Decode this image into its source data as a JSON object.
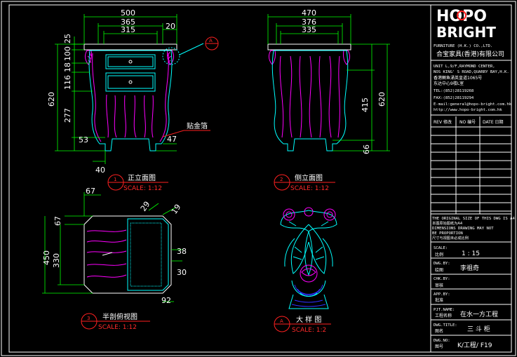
{
  "logo": {
    "top": "HOPO",
    "bottom": "BRIGHT"
  },
  "company": {
    "line_en": "FURNITURE (H.K.) CO.,LTD.",
    "line_cn": "合宝家具(香港)有限公司",
    "addr1": "UNIT L,9/F,RAYMOND CENTER,",
    "addr2": "NOS KING' S ROAD,QUARRY BAY,H.K.",
    "addr3": "香港鲗鱼涌英皇道1065号",
    "addr4": "东达中心9楼L室",
    "tel": "TEL:(852)28119268",
    "fax": "FAX:(852)28119294",
    "email": "E-mail:general@hopo-bright.com.hk",
    "web": "http://www.hopo-bright.com.hk"
  },
  "revision": {
    "rev": "REV 修改",
    "no": "NO 编号",
    "date": "DATE 日期"
  },
  "notice": [
    "THE ORIGINAL SIZE OF THIS DWG IS A4",
    "本图原始图纸为A4",
    "DIMENSIONS DRAWING MAY NOT",
    "BE PROPORTION",
    "尺寸与视图未必成比例"
  ],
  "title_block": {
    "scale_label": "SCALE:",
    "scale_cn": "比例",
    "scale_value": "1 : 15",
    "dwg_by_label": "DWG.BY:",
    "dwg_by_cn": "绘图",
    "dwg_by_value": "李祖奇",
    "chk_by_label": "CHK.BY:",
    "chk_by_cn": "审核",
    "app_by_label": "APP.BY:",
    "app_by_cn": "批准",
    "prj_label": "PJT.NAME:",
    "prj_cn": "工程名称",
    "prj_value": "在水一方工程",
    "dwg_title_label": "DWG.TITLE:",
    "dwg_title_cn": "图名",
    "dwg_title_value": "三 斗 柜",
    "dwg_no_label": "DWG.NO:",
    "dwg_no_cn": "图号",
    "dwg_no_value": "K/工程/ F19"
  },
  "front_view": {
    "num": "1",
    "title": "正立面图",
    "scale": "SCALE: 1:12",
    "dims_top": [
      "500",
      "365",
      "315"
    ],
    "dims_right_top": "20",
    "dims_left": [
      "25",
      "100",
      "18",
      "116",
      "277",
      "53"
    ],
    "dim_total": "620",
    "dim_leg": "47",
    "dim_bottom": "40",
    "note": "贴金箔",
    "callout": "A"
  },
  "side_view": {
    "num": "2",
    "title": "侧立面图",
    "scale": "SCALE: 1:12",
    "dims_top": [
      "470",
      "376",
      "335"
    ],
    "dims_right": [
      "415",
      "620",
      "66"
    ]
  },
  "section_view": {
    "num": "3",
    "title": "半剖俯视图",
    "scale": "SCALE: 1:12",
    "dims": [
      "67",
      "67",
      "450",
      "330",
      "29",
      "19",
      "38",
      "30",
      "92"
    ]
  },
  "detail_view": {
    "num": "A",
    "title": "大 样 图",
    "scale": "SCALE: 1:2"
  },
  "colors": {
    "frame": "#ffffff",
    "dim": "#00ff00",
    "cyan": "#00ffff",
    "magenta": "#ff00ff",
    "red": "#ff2020",
    "yellow": "#ffff00",
    "blue": "#3030ff"
  }
}
